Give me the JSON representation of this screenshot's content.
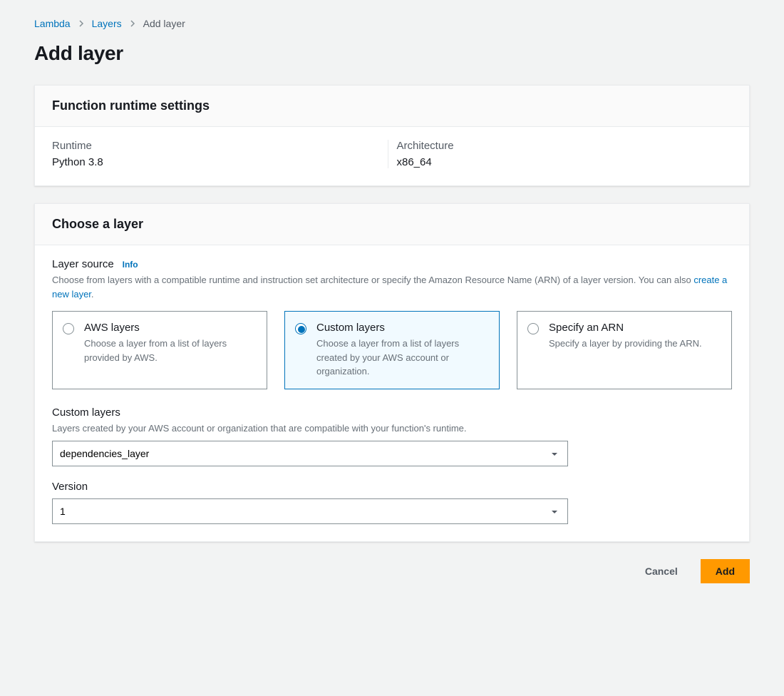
{
  "breadcrumb": {
    "items": [
      "Lambda",
      "Layers"
    ],
    "current": "Add layer"
  },
  "page_title": "Add layer",
  "runtime_panel": {
    "header": "Function runtime settings",
    "runtime_label": "Runtime",
    "runtime_value": "Python 3.8",
    "arch_label": "Architecture",
    "arch_value": "x86_64"
  },
  "choose_panel": {
    "header": "Choose a layer",
    "layer_source_label": "Layer source",
    "info_label": "Info",
    "layer_source_help_1": "Choose from layers with a compatible runtime and instruction set architecture or specify the Amazon Resource Name (ARN) of a layer version. You can also ",
    "layer_source_help_link": "create a new layer",
    "layer_source_help_2": ".",
    "options": [
      {
        "title": "AWS layers",
        "desc": "Choose a layer from a list of layers provided by AWS.",
        "selected": false
      },
      {
        "title": "Custom layers",
        "desc": "Choose a layer from a list of layers created by your AWS account or organization.",
        "selected": true
      },
      {
        "title": "Specify an ARN",
        "desc": "Specify a layer by providing the ARN.",
        "selected": false
      }
    ],
    "custom_layers_label": "Custom layers",
    "custom_layers_help": "Layers created by your AWS account or organization that are compatible with your function's runtime.",
    "custom_layers_value": "dependencies_layer",
    "version_label": "Version",
    "version_value": "1"
  },
  "footer": {
    "cancel": "Cancel",
    "add": "Add"
  }
}
